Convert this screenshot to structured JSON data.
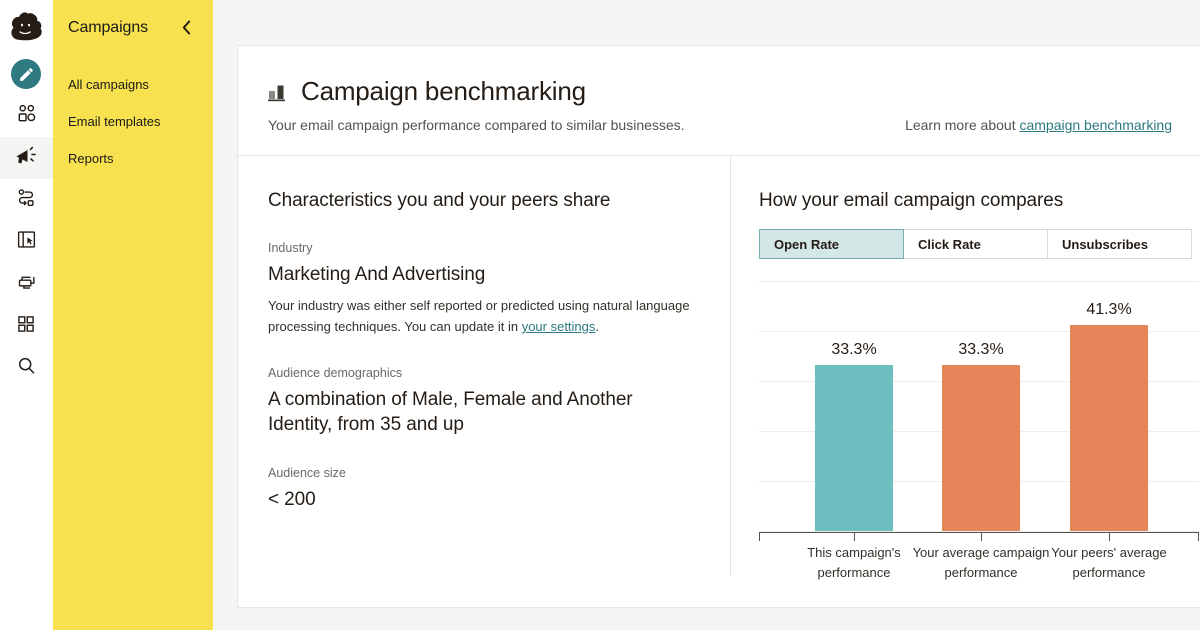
{
  "colors": {
    "sidebar_yellow": "#F8E14E",
    "teal_accent": "#2E7A80",
    "bar_teal": "#6CBFBE",
    "bar_orange": "#E8845A",
    "tab_active_bg": "#D4E7E7",
    "link": "#2C7A7F"
  },
  "rail": {
    "logo": "mailchimp-logo",
    "items": [
      {
        "name": "create-campaign-icon",
        "icon": "pencil-icon",
        "active": true
      },
      {
        "name": "audience-icon",
        "icon": "people-icon",
        "active": false
      },
      {
        "name": "campaigns-icon",
        "icon": "megaphone-icon",
        "active": false
      },
      {
        "name": "automations-icon",
        "icon": "flow-icon",
        "active": false
      },
      {
        "name": "website-icon",
        "icon": "browser-icon",
        "active": false
      },
      {
        "name": "content-studio-icon",
        "icon": "printer-icon",
        "active": false
      },
      {
        "name": "integrations-icon",
        "icon": "grid-icon",
        "active": false
      },
      {
        "name": "search-icon",
        "icon": "magnifier-icon",
        "active": false
      }
    ]
  },
  "sidebar": {
    "title": "Campaigns",
    "collapse_icon": "chevron-left-icon",
    "items": [
      {
        "label": "All campaigns"
      },
      {
        "label": "Email templates"
      },
      {
        "label": "Reports"
      }
    ]
  },
  "header": {
    "icon": "bar-chart-icon",
    "title": "Campaign benchmarking",
    "subtitle": "Your email campaign performance compared to similar businesses.",
    "learn_more_prefix": "Learn more about ",
    "learn_more_link": "campaign benchmarking"
  },
  "left_panel": {
    "heading": "Characteristics you and your peers share",
    "industry_label": "Industry",
    "industry_value": "Marketing And Advertising",
    "industry_note_prefix": "Your industry was either self reported or predicted using natural language processing techniques. You can update it in ",
    "industry_note_link": "your settings",
    "industry_note_suffix": ".",
    "demographics_label": "Audience demographics",
    "demographics_value": "A combination of Male, Female and Another Identity, from 35 and up",
    "audience_size_label": "Audience size",
    "audience_size_value": "< 200"
  },
  "right_panel": {
    "heading": "How your email campaign compares",
    "tabs": [
      {
        "label": "Open Rate",
        "active": true
      },
      {
        "label": "Click Rate",
        "active": false
      },
      {
        "label": "Unsubscribes",
        "active": false
      }
    ]
  },
  "chart_data": {
    "type": "bar",
    "title": "How your email campaign compares",
    "metric": "Open Rate",
    "categories": [
      "This campaign's performance",
      "Your average campaign performance",
      "Your peers' average performance"
    ],
    "values": [
      33.3,
      33.3,
      41.3
    ],
    "value_labels": [
      "33.3%",
      "33.3%",
      "41.3%"
    ],
    "colors": [
      "#6CBFBE",
      "#E8845A",
      "#E8845A"
    ],
    "unit": "%",
    "ylim": [
      0,
      50
    ],
    "grid": true,
    "gridline_count": 6,
    "legend": "none",
    "xlabel": "",
    "ylabel": ""
  }
}
